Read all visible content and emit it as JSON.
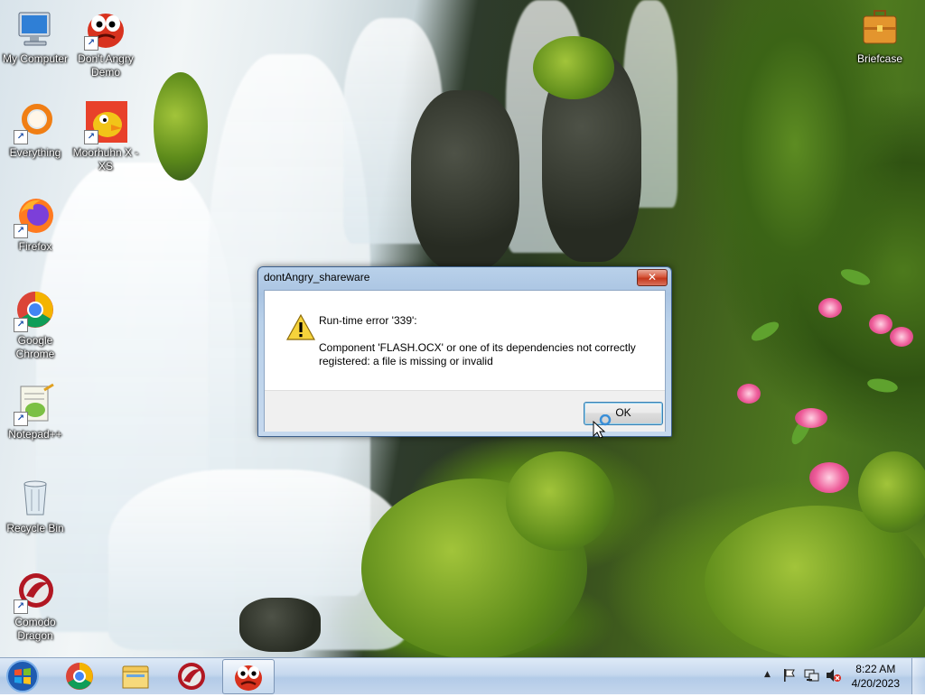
{
  "desktop_icons": [
    {
      "label": "My Computer",
      "icon": "computer-icon"
    },
    {
      "label": "Don't Angry Demo",
      "icon": "angry-face-icon"
    },
    {
      "label": "Everything",
      "icon": "everything-search-icon"
    },
    {
      "label": "Moorhuhn X - XS",
      "icon": "moorhuhn-icon"
    },
    {
      "label": "Firefox",
      "icon": "firefox-icon"
    },
    {
      "label": "Google Chrome",
      "icon": "chrome-icon"
    },
    {
      "label": "Notepad++",
      "icon": "notepadpp-icon"
    },
    {
      "label": "Recycle Bin",
      "icon": "recycle-bin-icon"
    },
    {
      "label": "Comodo Dragon",
      "icon": "comodo-dragon-icon"
    },
    {
      "label": "Briefcase",
      "icon": "briefcase-icon"
    }
  ],
  "dialog": {
    "title": "dontAngry_shareware",
    "close_glyph": "✕",
    "heading": "Run-time error '339':",
    "message": "Component 'FLASH.OCX' or one of its dependencies not correctly registered: a file is missing or invalid",
    "ok_label": "OK",
    "icon": "warning-icon"
  },
  "taskbar": {
    "start_icon": "windows-start-icon",
    "pinned": [
      {
        "name": "Google Chrome",
        "icon": "chrome-icon"
      },
      {
        "name": "Windows Explorer",
        "icon": "folder-icon"
      },
      {
        "name": "Comodo Dragon",
        "icon": "comodo-dragon-icon"
      },
      {
        "name": "Don't Angry",
        "icon": "angry-face-icon",
        "active": true
      }
    ],
    "tray": {
      "show_hidden_glyph": "▲",
      "icons": [
        "action-center-flag-icon",
        "network-icon",
        "volume-muted-icon"
      ],
      "time": "8:22 AM",
      "date": "4/20/2023"
    }
  },
  "colors": {
    "taskbar": "#c6d8ee",
    "dialog_frame": "#b9d1ea",
    "close_button": "#c4381c",
    "desktop_label": "#ffffff"
  }
}
